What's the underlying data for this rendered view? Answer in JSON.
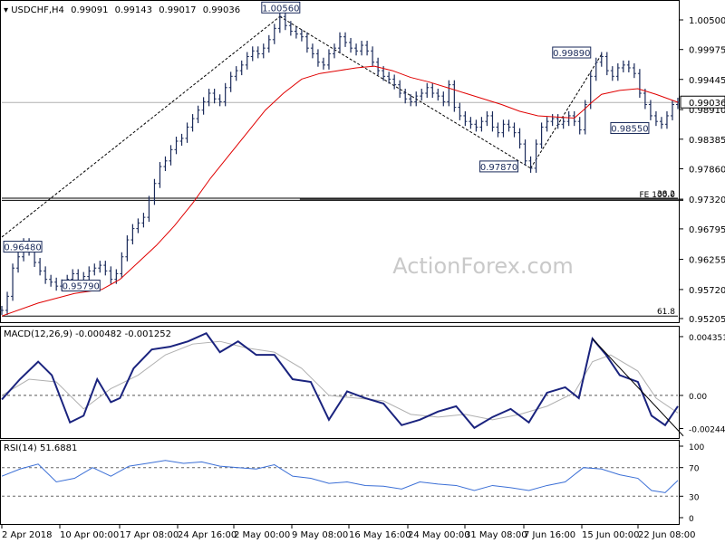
{
  "chart_data": {
    "type": "line",
    "symbol_header": "USDCHF,H4",
    "ohlc_header": [
      "0.99091",
      "0.99143",
      "0.99017",
      "0.99036"
    ],
    "watermark": "ActionForex.com",
    "price_axis": {
      "ticks": [
        "1.00500",
        "0.99975",
        "0.99445",
        "0.98910",
        "0.98385",
        "0.97860",
        "0.97320",
        "0.96795",
        "0.96255",
        "0.95720",
        "0.95205"
      ],
      "ylim": [
        0.95205,
        1.005
      ],
      "current_price_label": "0.99036",
      "current_price": 0.99036
    },
    "time_axis": {
      "ticks": [
        "2 Apr 2018",
        "10 Apr 00:00",
        "17 Apr 08:00",
        "24 Apr 16:00",
        "2 May 00:00",
        "9 May 08:00",
        "16 May 16:00",
        "24 May 00:00",
        "31 May 08:00",
        "7 Jun 16:00",
        "15 Jun 00:00",
        "22 Jun 08:00"
      ]
    },
    "price_series": {
      "name": "USDCHF H4",
      "points": [
        [
          0,
          0.9535
        ],
        [
          6,
          0.956
        ],
        [
          12,
          0.961
        ],
        [
          18,
          0.963
        ],
        [
          24,
          0.9655
        ],
        [
          30,
          0.964
        ],
        [
          36,
          0.962
        ],
        [
          42,
          0.9605
        ],
        [
          48,
          0.959
        ],
        [
          54,
          0.9585
        ],
        [
          60,
          0.9578
        ],
        [
          66,
          0.9582
        ],
        [
          72,
          0.959
        ],
        [
          78,
          0.96
        ],
        [
          84,
          0.9585
        ],
        [
          90,
          0.9595
        ],
        [
          96,
          0.9605
        ],
        [
          102,
          0.961
        ],
        [
          108,
          0.9615
        ],
        [
          114,
          0.9605
        ],
        [
          120,
          0.959
        ],
        [
          126,
          0.96
        ],
        [
          132,
          0.963
        ],
        [
          138,
          0.966
        ],
        [
          144,
          0.968
        ],
        [
          150,
          0.969
        ],
        [
          156,
          0.97
        ],
        [
          162,
          0.973
        ],
        [
          168,
          0.976
        ],
        [
          174,
          0.979
        ],
        [
          180,
          0.98
        ],
        [
          186,
          0.982
        ],
        [
          192,
          0.9835
        ],
        [
          198,
          0.984
        ],
        [
          204,
          0.986
        ],
        [
          210,
          0.9875
        ],
        [
          216,
          0.989
        ],
        [
          222,
          0.9905
        ],
        [
          228,
          0.992
        ],
        [
          234,
          0.991
        ],
        [
          240,
          0.9905
        ],
        [
          246,
          0.993
        ],
        [
          252,
          0.995
        ],
        [
          258,
          0.996
        ],
        [
          264,
          0.997
        ],
        [
          270,
          0.9985
        ],
        [
          276,
          0.9995
        ],
        [
          282,
          0.999
        ],
        [
          288,
          1.0
        ],
        [
          294,
          1.0015
        ],
        [
          300,
          1.0035
        ],
        [
          306,
          1.0056
        ],
        [
          312,
          1.004
        ],
        [
          318,
          1.003
        ],
        [
          324,
          1.0025
        ],
        [
          330,
          1.002
        ],
        [
          336,
          1.0
        ],
        [
          342,
          0.999
        ],
        [
          348,
          0.9975
        ],
        [
          354,
          0.997
        ],
        [
          360,
          0.999
        ],
        [
          366,
          1.0
        ],
        [
          372,
          1.002
        ],
        [
          378,
          1.001
        ],
        [
          384,
          1.0
        ],
        [
          390,
          0.9995
        ],
        [
          396,
          1.0005
        ],
        [
          402,
          0.9995
        ],
        [
          408,
          0.9975
        ],
        [
          414,
          0.996
        ],
        [
          420,
          0.995
        ],
        [
          426,
          0.9945
        ],
        [
          432,
          0.9935
        ],
        [
          438,
          0.992
        ],
        [
          444,
          0.991
        ],
        [
          450,
          0.9905
        ],
        [
          456,
          0.9915
        ],
        [
          462,
          0.992
        ],
        [
          468,
          0.993
        ],
        [
          474,
          0.992
        ],
        [
          480,
          0.9915
        ],
        [
          486,
          0.9905
        ],
        [
          492,
          0.9935
        ],
        [
          498,
          0.9895
        ],
        [
          504,
          0.988
        ],
        [
          510,
          0.987
        ],
        [
          516,
          0.9865
        ],
        [
          522,
          0.986
        ],
        [
          528,
          0.987
        ],
        [
          534,
          0.988
        ],
        [
          540,
          0.986
        ],
        [
          546,
          0.985
        ],
        [
          552,
          0.9865
        ],
        [
          558,
          0.986
        ],
        [
          564,
          0.985
        ],
        [
          570,
          0.983
        ],
        [
          576,
          0.98
        ],
        [
          582,
          0.9787
        ],
        [
          588,
          0.983
        ],
        [
          594,
          0.986
        ],
        [
          600,
          0.987
        ],
        [
          606,
          0.9875
        ],
        [
          612,
          0.9865
        ],
        [
          618,
          0.987
        ],
        [
          624,
          0.988
        ],
        [
          630,
          0.987
        ],
        [
          636,
          0.9855
        ],
        [
          642,
          0.99
        ],
        [
          648,
          0.995
        ],
        [
          654,
          0.9975
        ],
        [
          660,
          0.9985
        ],
        [
          666,
          0.996
        ],
        [
          672,
          0.995
        ],
        [
          678,
          0.9965
        ],
        [
          684,
          0.997
        ],
        [
          690,
          0.9965
        ],
        [
          696,
          0.9955
        ],
        [
          702,
          0.992
        ],
        [
          708,
          0.99
        ],
        [
          714,
          0.988
        ],
        [
          720,
          0.987
        ],
        [
          726,
          0.9865
        ],
        [
          732,
          0.988
        ],
        [
          738,
          0.99
        ],
        [
          744,
          0.9904
        ]
      ]
    },
    "ma_series": {
      "color": "#e00000",
      "points": [
        [
          0,
          0.9525
        ],
        [
          40,
          0.9548
        ],
        [
          80,
          0.9565
        ],
        [
          110,
          0.9572
        ],
        [
          130,
          0.959
        ],
        [
          150,
          0.962
        ],
        [
          170,
          0.965
        ],
        [
          190,
          0.9685
        ],
        [
          210,
          0.9725
        ],
        [
          230,
          0.977
        ],
        [
          250,
          0.981
        ],
        [
          270,
          0.985
        ],
        [
          290,
          0.989
        ],
        [
          310,
          0.992
        ],
        [
          330,
          0.9945
        ],
        [
          350,
          0.9955
        ],
        [
          370,
          0.996
        ],
        [
          390,
          0.9965
        ],
        [
          410,
          0.9968
        ],
        [
          430,
          0.996
        ],
        [
          450,
          0.9948
        ],
        [
          470,
          0.994
        ],
        [
          490,
          0.993
        ],
        [
          510,
          0.992
        ],
        [
          530,
          0.991
        ],
        [
          550,
          0.99
        ],
        [
          570,
          0.9888
        ],
        [
          590,
          0.988
        ],
        [
          610,
          0.9878
        ],
        [
          630,
          0.9876
        ],
        [
          640,
          0.989
        ],
        [
          650,
          0.9905
        ],
        [
          660,
          0.9918
        ],
        [
          680,
          0.9925
        ],
        [
          700,
          0.9928
        ],
        [
          720,
          0.9918
        ],
        [
          744,
          0.9904
        ]
      ]
    },
    "dashed_trendlines": [
      {
        "from": [
          0,
          0.9665
        ],
        "to": [
          306,
          1.0056
        ]
      },
      {
        "from": [
          306,
          1.0056
        ],
        "to": [
          582,
          0.9787
        ]
      },
      {
        "from": [
          582,
          0.9787
        ],
        "to": [
          660,
          0.9989
        ]
      }
    ],
    "horizontal_lines": [
      {
        "value": 0.973,
        "x_from": 0,
        "x_to": 750
      },
      {
        "value": 0.9732,
        "x_from": 328,
        "x_to": 750,
        "label": "FE 100.0"
      },
      {
        "value": 0.9734,
        "label": "38.2"
      },
      {
        "value": 0.9525,
        "label": "61.8"
      }
    ],
    "price_annotations": [
      {
        "label": "1.00560",
        "x": 306,
        "value": 1.0056
      },
      {
        "label": "0.96480",
        "x": 20,
        "value": 0.9648
      },
      {
        "label": "0.95790",
        "x": 92,
        "value": 0.9579
      },
      {
        "label": "0.97870",
        "x": 582,
        "value": 0.9787
      },
      {
        "label": "0.99890",
        "x": 660,
        "value": 0.9989
      },
      {
        "label": "0.98550",
        "x": 720,
        "value": 0.9855
      }
    ],
    "macd": {
      "header": "MACD(12,26,9) -0.000482 -0.001252",
      "ticks": [
        "0.004351",
        "0.00",
        "-0.002448"
      ],
      "ylim": [
        -0.00275,
        0.00475
      ],
      "zero_label": "0.00",
      "macd_points": [
        [
          0,
          -0.0003
        ],
        [
          20,
          0.0012
        ],
        [
          40,
          0.0025
        ],
        [
          55,
          0.0015
        ],
        [
          75,
          -0.002
        ],
        [
          90,
          -0.0015
        ],
        [
          105,
          0.0012
        ],
        [
          120,
          -0.0005
        ],
        [
          130,
          -0.0002
        ],
        [
          145,
          0.002
        ],
        [
          165,
          0.0034
        ],
        [
          185,
          0.0036
        ],
        [
          205,
          0.004
        ],
        [
          225,
          0.0046
        ],
        [
          240,
          0.0032
        ],
        [
          260,
          0.004
        ],
        [
          280,
          0.003
        ],
        [
          300,
          0.003
        ],
        [
          320,
          0.0012
        ],
        [
          340,
          0.001
        ],
        [
          360,
          -0.0018
        ],
        [
          380,
          0.0003
        ],
        [
          400,
          -0.0002
        ],
        [
          420,
          -0.0006
        ],
        [
          440,
          -0.0022
        ],
        [
          460,
          -0.0018
        ],
        [
          480,
          -0.0012
        ],
        [
          500,
          -0.0008
        ],
        [
          520,
          -0.0024
        ],
        [
          540,
          -0.0016
        ],
        [
          560,
          -0.001
        ],
        [
          580,
          -0.002
        ],
        [
          600,
          0.0002
        ],
        [
          620,
          0.0006
        ],
        [
          635,
          -0.0002
        ],
        [
          650,
          0.0042
        ],
        [
          665,
          0.003
        ],
        [
          680,
          0.0015
        ],
        [
          700,
          0.001
        ],
        [
          715,
          -0.0015
        ],
        [
          730,
          -0.0022
        ],
        [
          744,
          -0.0008
        ]
      ],
      "signal_points": [
        [
          0,
          0.0
        ],
        [
          30,
          0.0012
        ],
        [
          60,
          0.001
        ],
        [
          90,
          -0.001
        ],
        [
          120,
          0.0005
        ],
        [
          150,
          0.0015
        ],
        [
          180,
          0.003
        ],
        [
          210,
          0.0038
        ],
        [
          240,
          0.004
        ],
        [
          270,
          0.0035
        ],
        [
          300,
          0.0032
        ],
        [
          330,
          0.002
        ],
        [
          360,
          0.0
        ],
        [
          390,
          -0.0002
        ],
        [
          420,
          -0.0004
        ],
        [
          450,
          -0.0014
        ],
        [
          480,
          -0.0016
        ],
        [
          510,
          -0.0014
        ],
        [
          540,
          -0.0018
        ],
        [
          570,
          -0.0014
        ],
        [
          600,
          -0.0008
        ],
        [
          630,
          0.0002
        ],
        [
          650,
          0.0025
        ],
        [
          670,
          0.003
        ],
        [
          700,
          0.0018
        ],
        [
          720,
          -0.0002
        ],
        [
          744,
          -0.0013
        ]
      ],
      "trendline": {
        "from": [
          650,
          0.0042
        ],
        "to": [
          750,
          -0.003
        ]
      }
    },
    "rsi": {
      "header": "RSI(14) 51.6881",
      "ticks": [
        "100",
        "70",
        "30",
        "0"
      ],
      "levels": [
        70,
        30
      ],
      "points": [
        [
          0,
          58
        ],
        [
          20,
          68
        ],
        [
          40,
          75
        ],
        [
          60,
          50
        ],
        [
          80,
          55
        ],
        [
          100,
          70
        ],
        [
          120,
          58
        ],
        [
          140,
          72
        ],
        [
          160,
          76
        ],
        [
          180,
          80
        ],
        [
          200,
          76
        ],
        [
          220,
          78
        ],
        [
          240,
          72
        ],
        [
          260,
          70
        ],
        [
          280,
          68
        ],
        [
          300,
          74
        ],
        [
          320,
          58
        ],
        [
          340,
          55
        ],
        [
          360,
          48
        ],
        [
          380,
          50
        ],
        [
          400,
          45
        ],
        [
          420,
          44
        ],
        [
          440,
          40
        ],
        [
          460,
          50
        ],
        [
          480,
          47
        ],
        [
          500,
          45
        ],
        [
          520,
          38
        ],
        [
          540,
          45
        ],
        [
          560,
          42
        ],
        [
          580,
          38
        ],
        [
          600,
          45
        ],
        [
          620,
          50
        ],
        [
          640,
          70
        ],
        [
          660,
          68
        ],
        [
          680,
          60
        ],
        [
          700,
          55
        ],
        [
          715,
          38
        ],
        [
          730,
          35
        ],
        [
          744,
          52
        ]
      ]
    }
  }
}
